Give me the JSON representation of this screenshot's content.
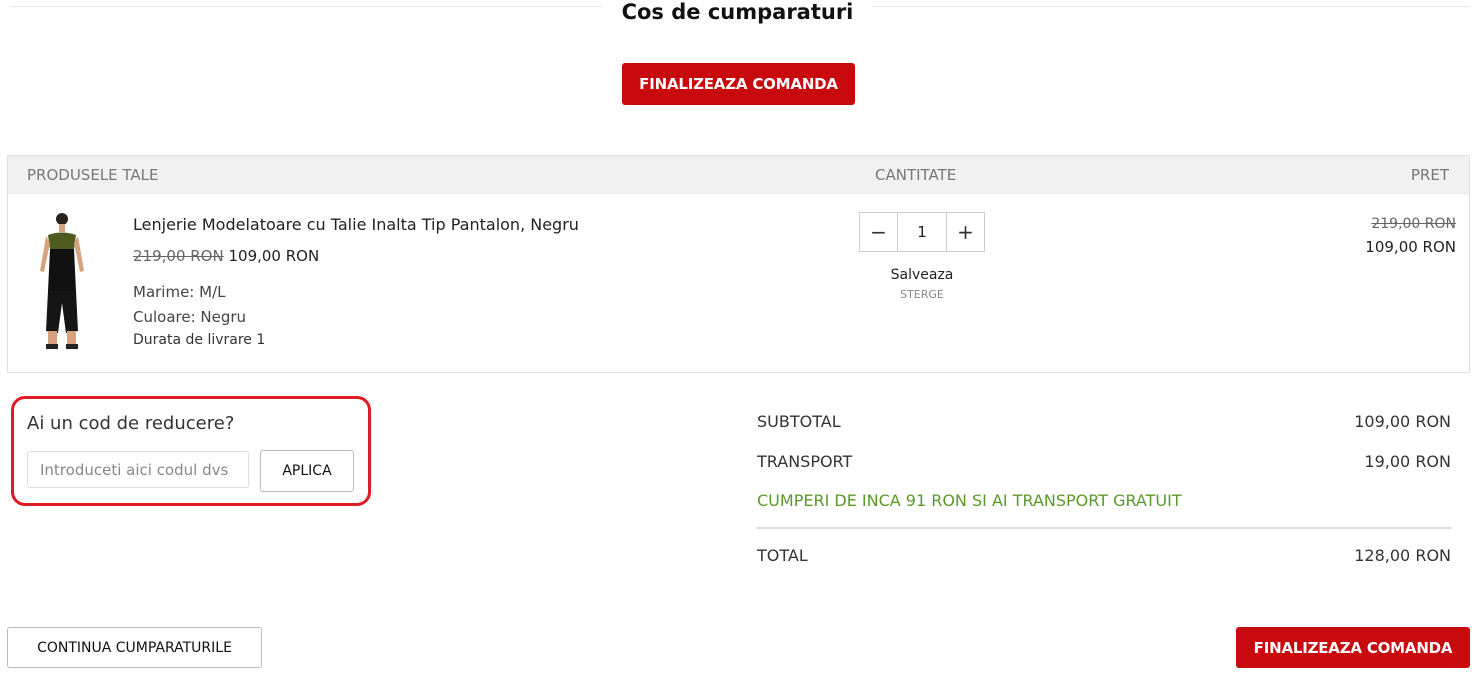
{
  "page": {
    "title": "Cos de cumparaturi"
  },
  "checkout": {
    "label": "FINALIZEAZA COMANDA"
  },
  "table": {
    "headers": {
      "products": "PRODUSELE TALE",
      "quantity": "CANTITATE",
      "price": "PRET"
    }
  },
  "item": {
    "name": "Lenjerie Modelatoare cu Talie Inalta Tip Pantalon, Negru",
    "old_price": "219,00 RON",
    "new_price": "109,00 RON",
    "size": "Marime: M/L",
    "color": "Culoare: Negru",
    "delivery": "Durata de livrare 1",
    "quantity": "1",
    "minus": "−",
    "plus": "+",
    "save_label": "Salveaza",
    "delete_label": "STERGE",
    "line_old_price": "219,00 RON",
    "line_new_price": "109,00 RON"
  },
  "discount": {
    "label": "Ai un cod de reducere?",
    "placeholder": "Introduceti aici codul dvs",
    "apply_label": "APLICA"
  },
  "summary": {
    "subtotal_label": "SUBTOTAL",
    "subtotal_value": "109,00 RON",
    "transport_label": "TRANSPORT",
    "transport_value": "19,00 RON",
    "free_shipping_note": "CUMPERI DE INCA 91 RON SI AI TRANSPORT GRATUIT",
    "total_label": "TOTAL",
    "total_value": "128,00 RON"
  },
  "continue": {
    "label": "CONTINUA CUMPARATURILE"
  },
  "colors": {
    "accent_red": "#c8090d",
    "highlight_red": "#e01b24",
    "promo_green": "#5b9a2a"
  }
}
